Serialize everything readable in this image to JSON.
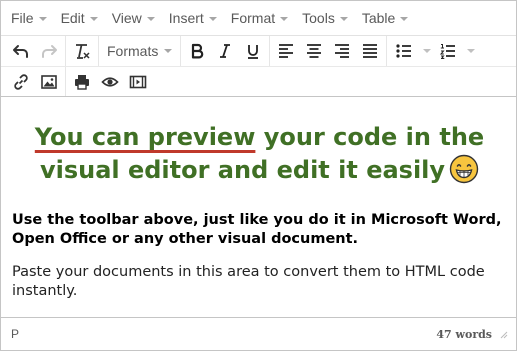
{
  "menubar": {
    "items": [
      "File",
      "Edit",
      "View",
      "Insert",
      "Format",
      "Tools",
      "Table"
    ]
  },
  "toolbar": {
    "format_label": "Formats",
    "icons": {
      "undo": "undo-icon",
      "redo": "redo-icon",
      "clear_formatting": "clear-formatting-icon",
      "bold": "bold-icon",
      "italic": "italic-icon",
      "underline": "underline-icon",
      "align_left": "align-left-icon",
      "align_center": "align-center-icon",
      "align_right": "align-right-icon",
      "justify": "align-justify-icon",
      "bullet_list": "bullet-list-icon",
      "numbered_list": "numbered-list-icon",
      "link": "link-icon",
      "image": "image-icon",
      "print": "print-icon",
      "preview": "preview-eye-icon",
      "media": "media-icon"
    }
  },
  "content": {
    "heading_part1": "You can preview",
    "heading_part2": " your code in the visual editor and edit it easily",
    "emoji": "grinning-face-emoji",
    "bold_paragraph": "Use the toolbar above, just like you do it in Microsoft Word, Open Office or any other visual document.",
    "paragraph": "Paste your documents in this area to convert them to HTML code instantly."
  },
  "statusbar": {
    "path": "P",
    "word_count": "47 words"
  },
  "colors": {
    "heading_green": "#407025",
    "underline_red": "#c0392b",
    "border": "#c5c5c5",
    "emoji_yellow": "#f7c53f"
  }
}
